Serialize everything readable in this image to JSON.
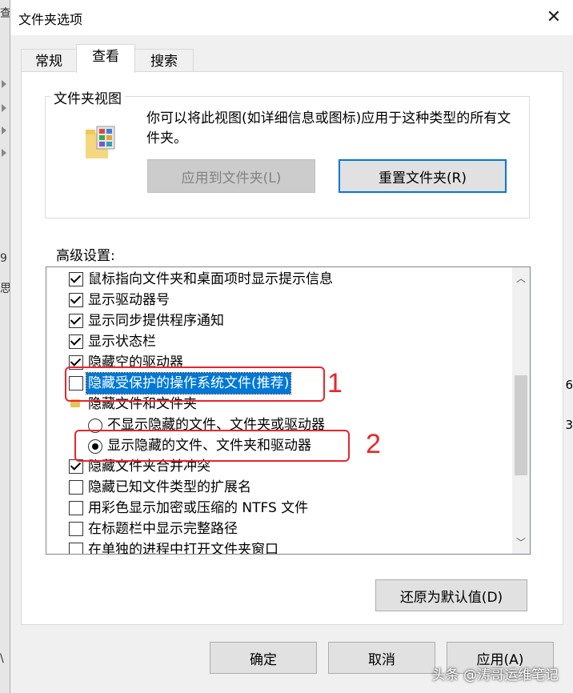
{
  "background": {
    "fragments": [
      "查",
      "9",
      "思",
      "6",
      "3",
      "\\"
    ]
  },
  "window": {
    "title": "文件夹选项",
    "close_glyph": "✕"
  },
  "tabs": [
    {
      "label": "常规",
      "active": false
    },
    {
      "label": "查看",
      "active": true
    },
    {
      "label": "搜索",
      "active": false
    }
  ],
  "folder_views": {
    "group_label": "文件夹视图",
    "description": "你可以将此视图(如详细信息或图标)应用于这种类型的所有文件夹。",
    "apply_button": "应用到文件夹(L)",
    "reset_button": "重置文件夹(R)"
  },
  "advanced": {
    "label": "高级设置:",
    "items": [
      {
        "kind": "checkbox",
        "checked": true,
        "label": "鼠标指向文件夹和桌面项时显示提示信息"
      },
      {
        "kind": "checkbox",
        "checked": true,
        "label": "显示驱动器号"
      },
      {
        "kind": "checkbox",
        "checked": true,
        "label": "显示同步提供程序通知"
      },
      {
        "kind": "checkbox",
        "checked": true,
        "label": "显示状态栏"
      },
      {
        "kind": "checkbox",
        "checked": true,
        "label": "隐藏空的驱动器"
      },
      {
        "kind": "checkbox",
        "checked": false,
        "label": "隐藏受保护的操作系统文件(推荐)",
        "selected": true
      },
      {
        "kind": "folder",
        "label": "隐藏文件和文件夹"
      },
      {
        "kind": "radio",
        "checked": false,
        "label": "不显示隐藏的文件、文件夹或驱动器"
      },
      {
        "kind": "radio",
        "checked": true,
        "label": "显示隐藏的文件、文件夹和驱动器"
      },
      {
        "kind": "checkbox",
        "checked": true,
        "label": "隐藏文件夹合并冲突"
      },
      {
        "kind": "checkbox",
        "checked": false,
        "label": "隐藏已知文件类型的扩展名"
      },
      {
        "kind": "checkbox",
        "checked": false,
        "label": "用彩色显示加密或压缩的 NTFS 文件"
      },
      {
        "kind": "checkbox",
        "checked": false,
        "label": "在标题栏中显示完整路径"
      },
      {
        "kind": "checkbox",
        "checked": false,
        "label": "在单独的进程中打开文件夹窗口"
      }
    ],
    "scroll_up": "︿",
    "scroll_down": "﹀"
  },
  "restore_button": "还原为默认值(D)",
  "footer": {
    "ok": "确定",
    "cancel": "取消",
    "apply": "应用(A)"
  },
  "annotations": {
    "mark1": "1",
    "mark2": "2",
    "color": "#e8262c"
  },
  "watermark": "头条 @涛哥运维笔记"
}
